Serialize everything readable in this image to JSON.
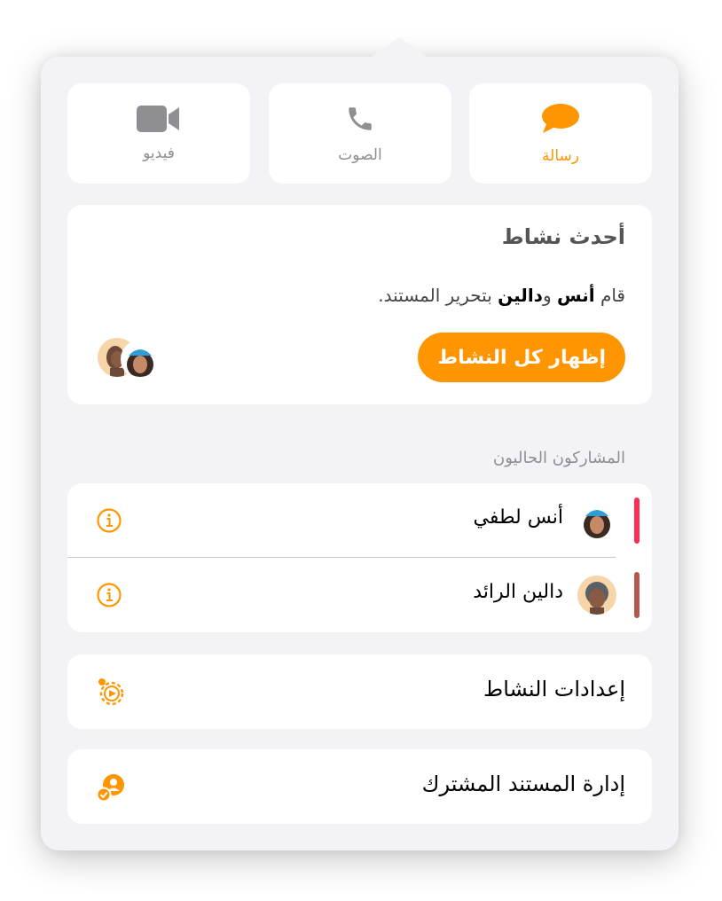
{
  "comm_buttons": {
    "video": {
      "label": "فيديو",
      "icon": "video-camera-icon"
    },
    "audio": {
      "label": "الصوت",
      "icon": "phone-icon"
    },
    "message": {
      "label": "رسالة",
      "icon": "message-bubble-icon"
    }
  },
  "activity": {
    "title": "أحدث نشاط",
    "desc_prefix": "قام ",
    "name1": "أنس",
    "conj": " و",
    "name2": "دالين",
    "desc_suffix": " بتحرير المستند.",
    "show_all_label": "إظهار كل النشاط"
  },
  "participants": {
    "section_label": "المشاركون الحاليون",
    "items": [
      {
        "name": "أنس لطفي",
        "color": "#ff2d55"
      },
      {
        "name": "دالين الرائد",
        "color": "#b4584b"
      }
    ]
  },
  "settings": {
    "label": "إعدادات النشاط",
    "icon": "activity-settings-icon"
  },
  "manage": {
    "label": "إدارة المستند المشترك",
    "icon": "manage-shared-icon"
  },
  "colors": {
    "accent": "#ff9500",
    "panel": "#f2f2f7",
    "card": "#ffffff"
  }
}
